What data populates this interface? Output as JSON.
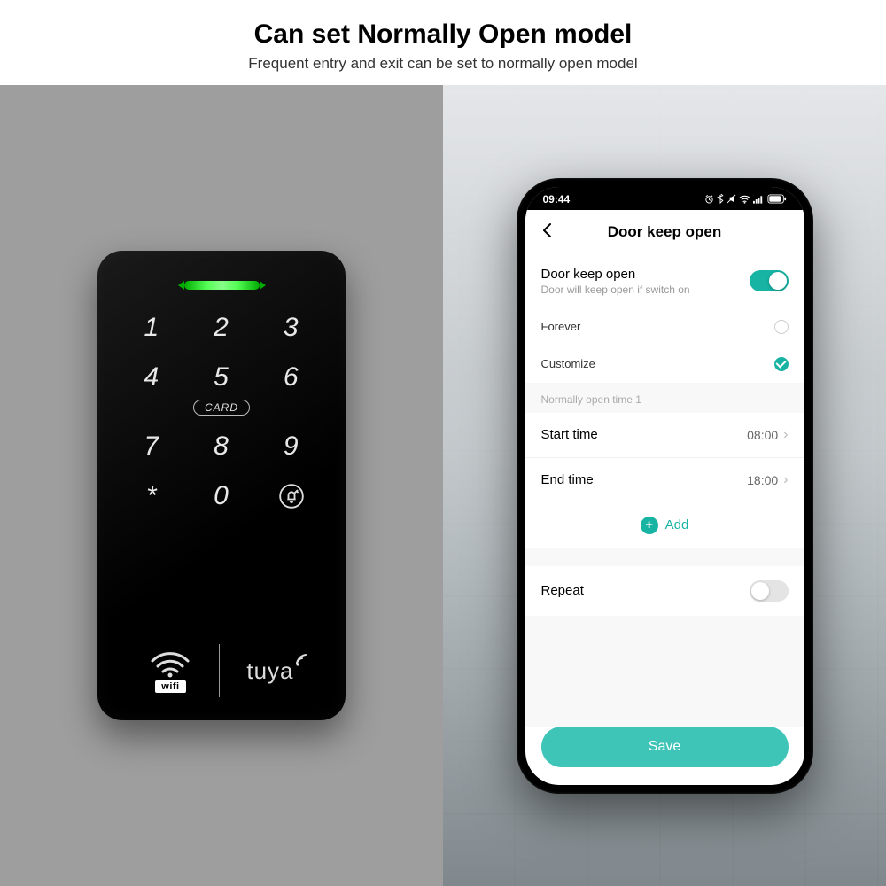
{
  "header": {
    "title": "Can set Normally Open model",
    "subtitle": "Frequent entry and exit can be set to normally open model"
  },
  "keypad": {
    "keys_row1": [
      "1",
      "2",
      "3"
    ],
    "keys_row2": [
      "4",
      "5",
      "6"
    ],
    "card_label": "CARD",
    "keys_row3": [
      "7",
      "8",
      "9"
    ],
    "keys_row4": [
      "*",
      "0"
    ],
    "wifi_label": "wifi",
    "brand": "tuya"
  },
  "phone": {
    "status_time": "09:44",
    "app_title": "Door keep open",
    "toggle": {
      "title": "Door keep open",
      "subtitle": "Door will keep open if switch on",
      "on": true
    },
    "options": {
      "forever": "Forever",
      "customize": "Customize"
    },
    "group_label": "Normally open time 1",
    "start": {
      "label": "Start time",
      "value": "08:00"
    },
    "end": {
      "label": "End time",
      "value": "18:00"
    },
    "add_label": "Add",
    "repeat_label": "Repeat",
    "repeat_on": false,
    "save_label": "Save"
  },
  "colors": {
    "accent": "#17b3a3"
  }
}
